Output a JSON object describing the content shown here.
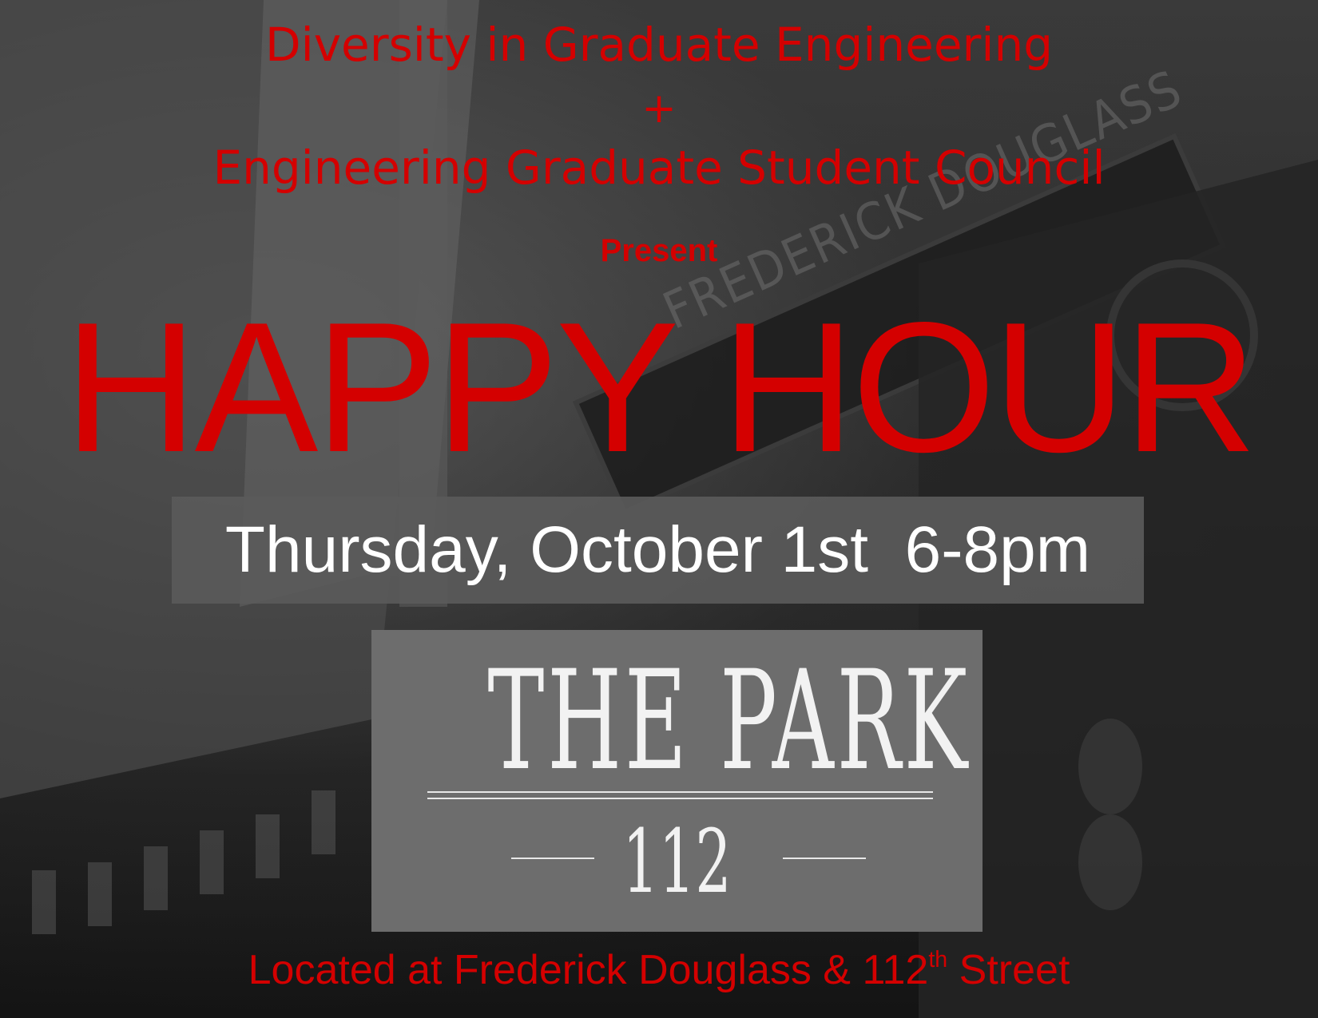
{
  "flyer": {
    "org_line1": "Diversity in Graduate Engineering",
    "plus": "+",
    "org_line2": "Engineering Graduate Student Council",
    "present": "Present",
    "headline": "HAPPY HOUR",
    "date_time": "Thursday, October 1st  6-8pm",
    "logo": {
      "name": "THE PARK",
      "number": "112",
      "background_color": "#6d6d6d"
    },
    "location_prefix": "Located at Frederick Douglass & 112",
    "location_sup": "th",
    "location_suffix": " Street",
    "background_sign_text": "FREDERICK DOUGLASS",
    "accent_color": "#d40000"
  }
}
